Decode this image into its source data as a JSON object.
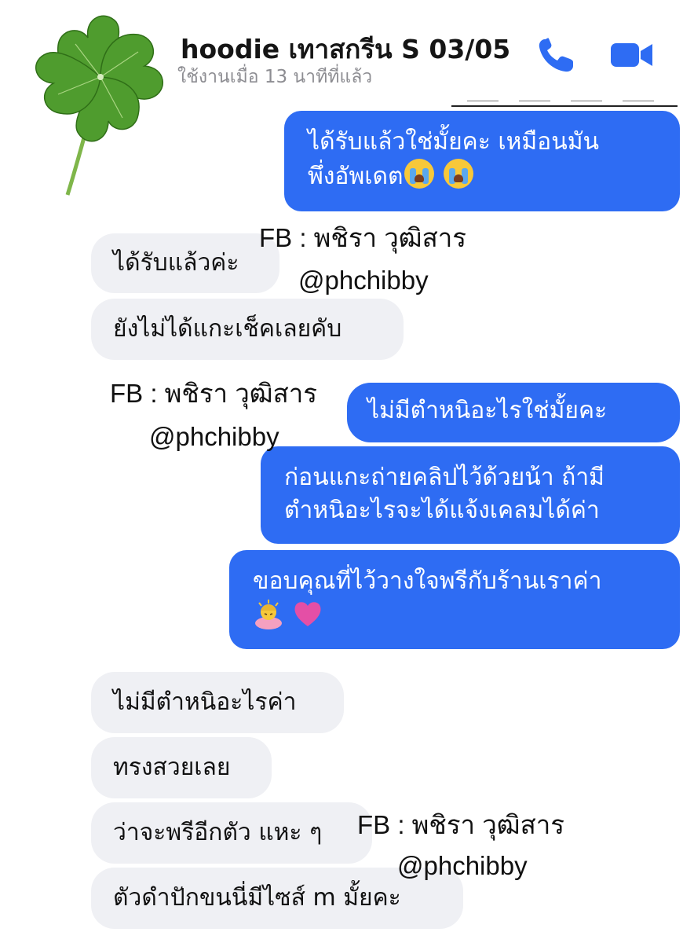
{
  "header": {
    "title": "hoodie เทาสกรีน S 03/05",
    "status": "ใช้งานเมื่อ 13 นาทีที่แล้ว",
    "call_icon": "phone-icon",
    "video_icon": "video-camera-icon"
  },
  "colors": {
    "accent": "#2e6cf3",
    "incoming_bg": "#eff0f4",
    "status_gray": "#8d8d92"
  },
  "messages": [
    {
      "direction": "out",
      "lines": [
        "ได้รับแล้วใช่มั้ยคะ เหมือนมัน",
        "พึ่งอัพเดต"
      ],
      "emoji": [
        "loudly-crying-face",
        "loudly-crying-face"
      ]
    },
    {
      "direction": "in",
      "text": "ได้รับแล้วค่ะ"
    },
    {
      "direction": "in",
      "text": "ยังไม่ได้แกะเช็คเลยคับ"
    },
    {
      "direction": "out",
      "text": "ไม่มีตำหนิอะไรใช่มั้ยคะ"
    },
    {
      "direction": "out",
      "lines": [
        "ก่อนแกะถ่ายคลิปไว้ด้วยน้า ถ้ามี",
        "ตำหนิอะไรจะได้แจ้งเคลมได้ค่า"
      ]
    },
    {
      "direction": "out",
      "lines": [
        "ขอบคุณที่ไว้วางใจพรีกับร้านเราค่า"
      ],
      "emoji": [
        "person-bowing",
        "pink-heart"
      ]
    },
    {
      "direction": "in",
      "text": "ไม่มีตำหนิอะไรค่า"
    },
    {
      "direction": "in",
      "text": "ทรงสวยเลย"
    },
    {
      "direction": "in",
      "text": "ว่าจะพรีอีกตัว แหะ ๆ"
    },
    {
      "direction": "in",
      "text": "ตัวดำปักขนนี่มีไซส์ m มั้ยคะ"
    }
  ],
  "watermark": {
    "name": "FB : พชิรา วุฒิสาร",
    "handle": "@phchibby"
  },
  "decorations": {
    "sticker": "four-leaf-clover"
  }
}
